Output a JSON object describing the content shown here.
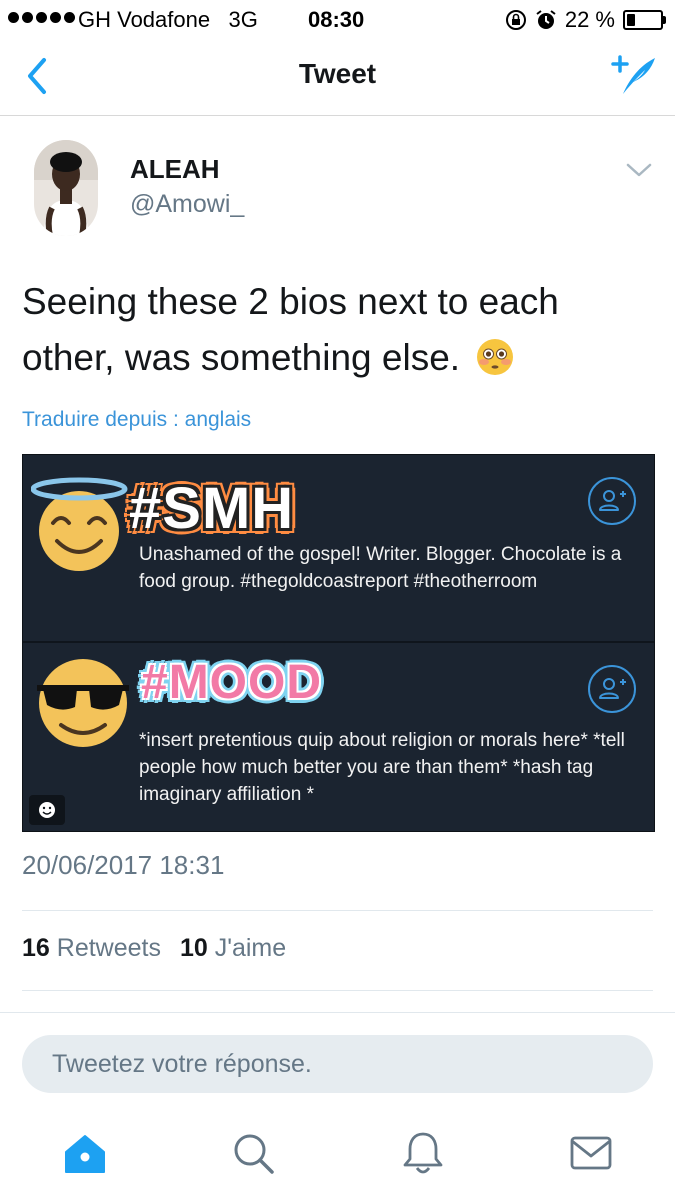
{
  "status_bar": {
    "carrier": "GH Vodafone",
    "network": "3G",
    "time": "08:30",
    "battery_text": "22 %",
    "battery_level": 0.22
  },
  "nav": {
    "title": "Tweet",
    "back_icon": "chevron-left-icon",
    "compose_icon": "compose-quill-icon"
  },
  "tweet": {
    "author_name": "ALEAH",
    "author_handle": "@Amowi_",
    "text": "Seeing these 2 bios next to each other, was something else.",
    "text_emoji": "flushed-face-icon",
    "translate_label": "Traduire depuis : anglais",
    "media": {
      "bio1": {
        "tag": "#SMH",
        "text": "Unashamed of the gospel!   Writer. Blogger. Chocolate is a food group. #thegoldcoastreport #theotherroom",
        "emoji": "smiling-face-with-halo-icon"
      },
      "bio2": {
        "tag": "#MOOD",
        "text": "*insert pretentious quip about religion or morals here* *tell people how much better you are than them* *hash tag imaginary affiliation *",
        "emoji": "smiling-face-with-sunglasses-icon"
      }
    },
    "timestamp": "20/06/2017 18:31",
    "retweets_count": "16",
    "retweets_label": "Retweets",
    "likes_count": "10",
    "likes_label": "J'aime"
  },
  "reply": {
    "placeholder": "Tweetez votre réponse."
  },
  "tabbar": {
    "items": [
      "home-icon",
      "search-icon",
      "notifications-bell-icon",
      "messages-envelope-icon"
    ],
    "active": "home-icon"
  },
  "colors": {
    "accent": "#1da1f2",
    "link": "#3b94d9",
    "secondary_text": "#657786",
    "media_bg": "#1b2430"
  }
}
